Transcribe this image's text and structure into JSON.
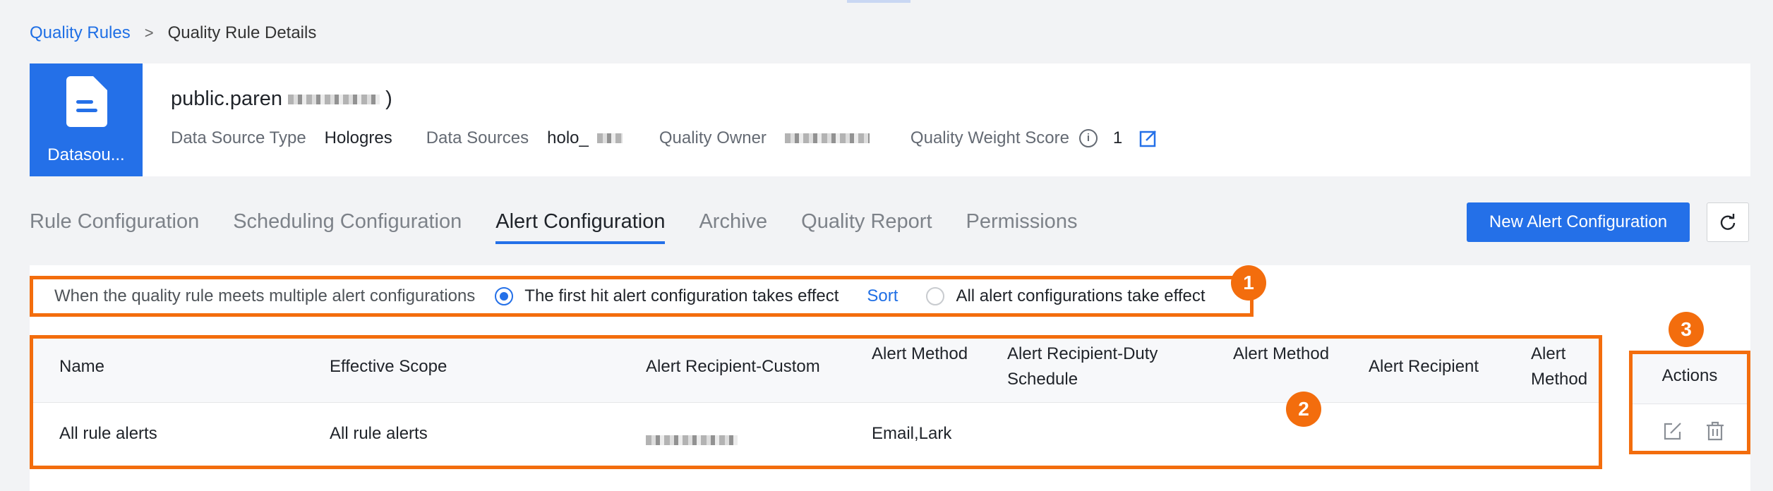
{
  "breadcrumb": {
    "parent": "Quality Rules",
    "separator": ">",
    "current": "Quality Rule Details"
  },
  "header": {
    "tile_label": "Datasou...",
    "title": "public.paren",
    "title_suffix": ")",
    "data_source_type_label": "Data Source Type",
    "data_source_type_value": "Hologres",
    "data_sources_label": "Data Sources",
    "data_sources_value": "holo_",
    "quality_owner_label": "Quality Owner",
    "quality_weight_score_label": "Quality Weight Score",
    "quality_weight_score_value": "1"
  },
  "tabs": [
    {
      "label": "Rule Configuration"
    },
    {
      "label": "Scheduling Configuration"
    },
    {
      "label": "Alert Configuration",
      "active": true
    },
    {
      "label": "Archive"
    },
    {
      "label": "Quality Report"
    },
    {
      "label": "Permissions"
    }
  ],
  "buttons": {
    "new_alert": "New Alert Configuration"
  },
  "options": {
    "label": "When the quality rule meets multiple alert configurations",
    "option_first": "The first hit alert configuration takes effect",
    "sort": "Sort",
    "option_all": "All alert configurations take effect",
    "selected": "first"
  },
  "table": {
    "columns": [
      "Name",
      "Effective Scope",
      "Alert Recipient-Custom",
      "Alert Method",
      "Alert Recipient-Duty Schedule",
      "Alert Method",
      "Alert Recipient",
      "Alert Method"
    ],
    "rows": [
      {
        "name": "All rule alerts",
        "scope": "All rule alerts",
        "recipient_custom": "",
        "method": "Email,Lark"
      }
    ]
  },
  "actions": {
    "header": "Actions"
  },
  "badges": [
    "1",
    "2",
    "3"
  ],
  "colors": {
    "accent": "#2470e8",
    "annotation": "#f36d0d"
  }
}
